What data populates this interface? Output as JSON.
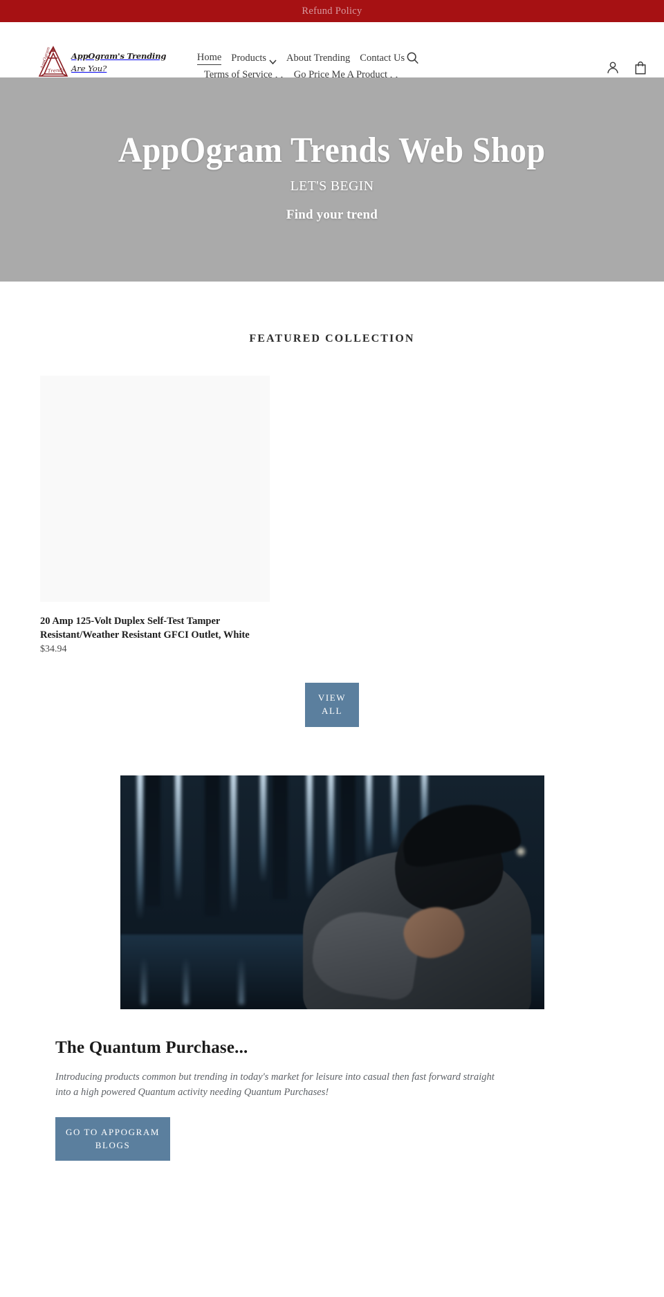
{
  "announcement": {
    "label": "Refund Policy"
  },
  "header": {
    "logo": {
      "line1": "AppOgram's Trending",
      "line2": "Are You?",
      "mark_label": "Trends",
      "icon": "penrose-triangle-logo"
    },
    "nav_row1": [
      {
        "label": "Home",
        "has_dropdown": false,
        "active": true
      },
      {
        "label": "Products",
        "has_dropdown": true,
        "active": false
      },
      {
        "label": "About Trending",
        "has_dropdown": false,
        "active": false
      },
      {
        "label": "Contact Us",
        "has_dropdown": false,
        "active": false
      }
    ],
    "nav_row2": [
      {
        "label": "Terms of Service",
        "has_dropdown": true,
        "active": false
      },
      {
        "label": "Go Price Me A Product",
        "has_dropdown": true,
        "active": false
      }
    ],
    "icons": {
      "search": "search-icon",
      "account": "account-icon",
      "cart": "cart-icon"
    }
  },
  "hero": {
    "title": "AppOgram Trends Web Shop",
    "subtitle": "LET'S BEGIN",
    "cta_text": "Find your trend",
    "background_color": "#aaaaaa"
  },
  "featured": {
    "title": "FEATURED COLLECTION",
    "products": [
      {
        "title": "20 Amp 125-Volt Duplex Self-Test Tamper Resistant/Weather Resistant GFCI Outlet, White",
        "price": "$34.94",
        "image_placeholder_color": "#f9f9f9"
      }
    ],
    "view_all_label": "VIEW ALL"
  },
  "feature_block": {
    "image_alt": "person-in-cap-neon-lights-photo",
    "heading": "The Quantum Purchase...",
    "body": "Introducing products common but trending in today's market for leisure into casual then fast forward straight into a high powered Quantum activity needing Quantum Purchases!",
    "button_label": "GO TO APPOGRAM BLOGS"
  },
  "colors": {
    "announcement_bg": "#a61113",
    "button_primary": "#5b7f9e",
    "hero_bg": "#aaaaaa",
    "logo_red": "#8c2126"
  }
}
